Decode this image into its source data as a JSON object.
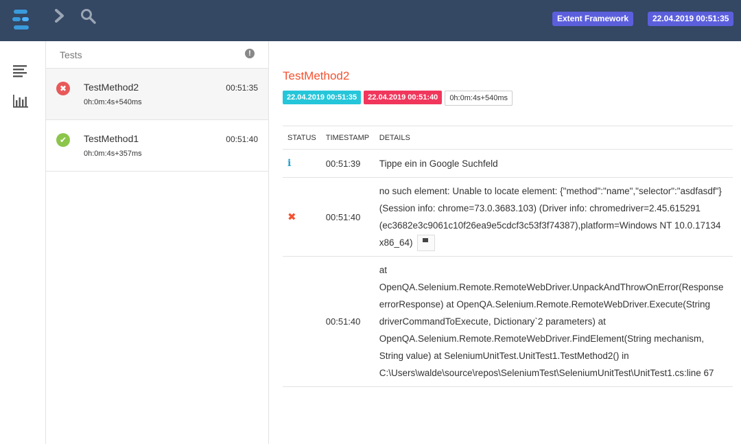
{
  "topbar": {
    "framework_label": "Extent Framework",
    "timestamp_label": "22.04.2019 00:51:35",
    "badge_color": "#5c5fdc",
    "background": "#344763",
    "icons": [
      "extent-logo-icon",
      "chevron-right-icon",
      "search-icon"
    ]
  },
  "sidebar": {
    "icons": [
      "list-icon",
      "bar-chart-icon"
    ]
  },
  "tests_panel": {
    "title": "Tests",
    "alert_symbol": "!",
    "tests": [
      {
        "name": "TestMethod2",
        "time": "00:51:35",
        "duration": "0h:0m:4s+540ms",
        "status": "fail",
        "status_symbol": "✖",
        "status_color": "#e8595a"
      },
      {
        "name": "TestMethod1",
        "time": "00:51:40",
        "duration": "0h:0m:4s+357ms",
        "status": "pass",
        "status_symbol": "✔",
        "status_color": "#8cc54a"
      }
    ]
  },
  "detail": {
    "title": "TestMethod2",
    "start_time": "22.04.2019 00:51:35",
    "end_time": "22.04.2019 00:51:40",
    "duration": "0h:0m:4s+540ms",
    "columns": [
      "STATUS",
      "TIMESTAMP",
      "DETAILS"
    ],
    "logs": [
      {
        "status": "info",
        "status_symbol": "i",
        "timestamp": "00:51:39",
        "details": "Tippe ein in Google Suchfeld"
      },
      {
        "status": "fail",
        "status_symbol": "✖",
        "timestamp": "00:51:40",
        "details": "no such element: Unable to locate element: {\"method\":\"name\",\"selector\":\"asdfasdf\"} (Session info: chrome=73.0.3683.103) (Driver info: chromedriver=2.45.615291 (ec3682e3c9061c10f26ea9e5cdcf3c53f3f74387),platform=Windows NT 10.0.17134 x86_64)"
      },
      {
        "status": "",
        "status_symbol": "",
        "timestamp": "00:51:40",
        "details": "at OpenQA.Selenium.Remote.RemoteWebDriver.UnpackAndThrowOnError(Response errorResponse) at OpenQA.Selenium.Remote.RemoteWebDriver.Execute(String driverCommandToExecute, Dictionary`2 parameters) at OpenQA.Selenium.Remote.RemoteWebDriver.FindElement(String mechanism, String value) at SeleniumUnitTest.UnitTest1.TestMethod2() in C:\\Users\\walde\\source\\repos\\SeleniumTest\\SeleniumUnitTest\\UnitTest1.cs:line 67"
      }
    ]
  }
}
